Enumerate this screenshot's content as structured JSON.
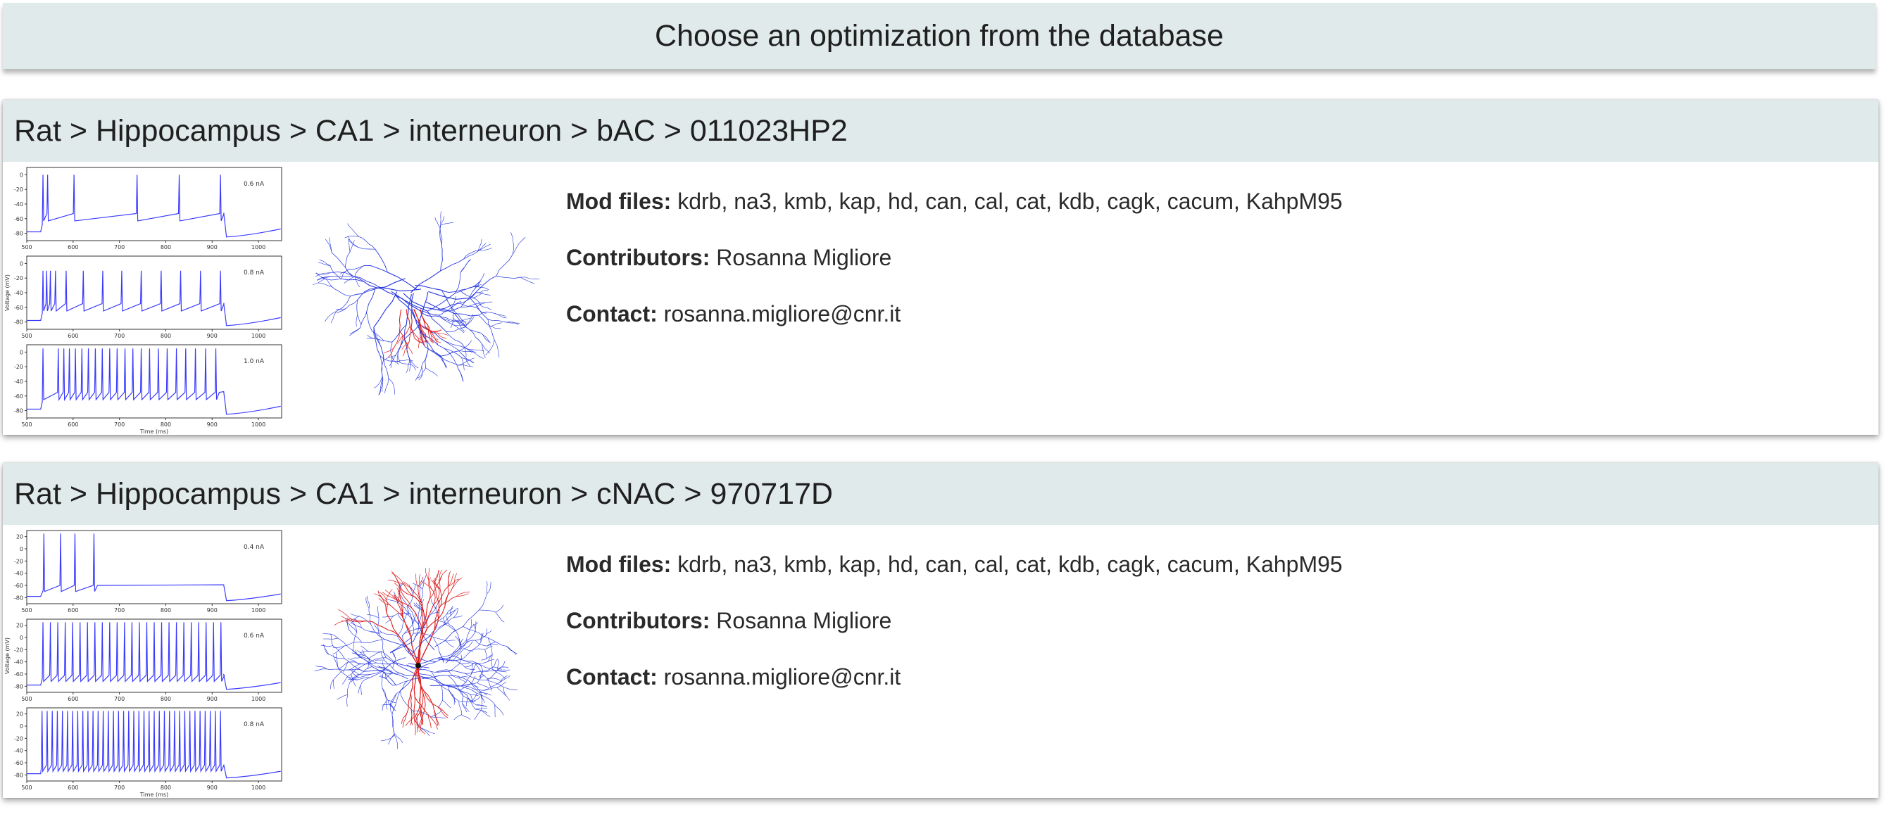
{
  "page": {
    "title": "Choose an optimization from the database"
  },
  "cards": [
    {
      "breadcrumb": [
        "Rat",
        "Hippocampus",
        "CA1",
        "interneuron",
        "bAC",
        "011023HP2"
      ],
      "separator": ">",
      "mod_files_label": "Mod files:",
      "mod_files_value": "kdrb, na3, kmb, kap, hd, can, cal, cat, kdb, cagk, cacum, KahpM95",
      "contributors_label": "Contributors:",
      "contributors_value": "Rosanna Migliore",
      "contact_label": "Contact:",
      "contact_value": "rosanna.migliore@cnr.it",
      "chart_data": {
        "type": "line",
        "xlabel": "Time (ms)",
        "ylabel": "Voltage (mV)",
        "xlim": [
          500,
          1050
        ],
        "x_ticks": [
          500,
          600,
          700,
          800,
          900,
          1000
        ],
        "y_ticks": [
          0,
          -20,
          -40,
          -60,
          -80
        ],
        "ylim": [
          -90,
          10
        ],
        "line_color": "#3a3aff",
        "panels": [
          {
            "current": "0.6 nA",
            "baseline": -53,
            "spike_peak": 0,
            "spike_times": [
              535,
              545,
              602,
              738,
              829,
              918
            ]
          },
          {
            "current": "0.8 nA",
            "baseline": -55,
            "spike_peak": -10,
            "spike_times": [
              535,
              543,
              551,
              562,
              585,
              622,
              664,
              705,
              747,
              790,
              832,
              875,
              918
            ]
          },
          {
            "current": "1.0 nA",
            "baseline": -55,
            "spike_peak": 5,
            "spike_times": [
              535,
              568,
              580,
              592,
              605,
              619,
              633,
              648,
              663,
              679,
              695,
              712,
              729,
              747,
              765,
              784,
              803,
              823,
              843,
              864,
              886,
              908
            ]
          }
        ]
      },
      "morphology": {
        "axon_color": "#2233dd",
        "dendrite_color": "#dd2222"
      }
    },
    {
      "breadcrumb": [
        "Rat",
        "Hippocampus",
        "CA1",
        "interneuron",
        "cNAC",
        "970717D"
      ],
      "separator": ">",
      "mod_files_label": "Mod files:",
      "mod_files_value": "kdrb, na3, kmb, kap, hd, can, cal, cat, kdb, cagk, cacum, KahpM95",
      "contributors_label": "Contributors:",
      "contributors_value": "Rosanna Migliore",
      "contact_label": "Contact:",
      "contact_value": "rosanna.migliore@cnr.it",
      "chart_data": {
        "type": "line",
        "xlabel": "Time (ms)",
        "ylabel": "Voltage (mV)",
        "xlim": [
          500,
          1050
        ],
        "x_ticks": [
          500,
          600,
          700,
          800,
          900,
          1000
        ],
        "y_ticks": [
          20,
          0,
          -20,
          -40,
          -60,
          -80
        ],
        "ylim": [
          -90,
          30
        ],
        "line_color": "#3a3aff",
        "panels": [
          {
            "current": "0.4 nA",
            "baseline": -60,
            "spike_peak": 25,
            "spike_times": [
              537,
              573,
              604,
              645
            ]
          },
          {
            "current": "0.6 nA",
            "baseline": -62,
            "spike_peak": 25,
            "spike_times": [
              535,
              551,
              567,
              583,
              599,
              615,
              631,
              647,
              663,
              679,
              695,
              711,
              727,
              743,
              759,
              775,
              791,
              807,
              823,
              839,
              855,
              871,
              887,
              903,
              919
            ]
          },
          {
            "current": "0.8 nA",
            "baseline": -64,
            "spike_peak": 25,
            "spike_times": [
              533,
              544,
              555,
              566,
              577,
              588,
              599,
              610,
              621,
              632,
              643,
              654,
              665,
              676,
              687,
              698,
              709,
              720,
              731,
              742,
              753,
              764,
              775,
              786,
              797,
              808,
              819,
              830,
              841,
              852,
              863,
              874,
              885,
              896,
              907,
              918
            ]
          }
        ]
      },
      "morphology": {
        "axon_color": "#2233dd",
        "dendrite_color": "#dd2222"
      }
    }
  ]
}
